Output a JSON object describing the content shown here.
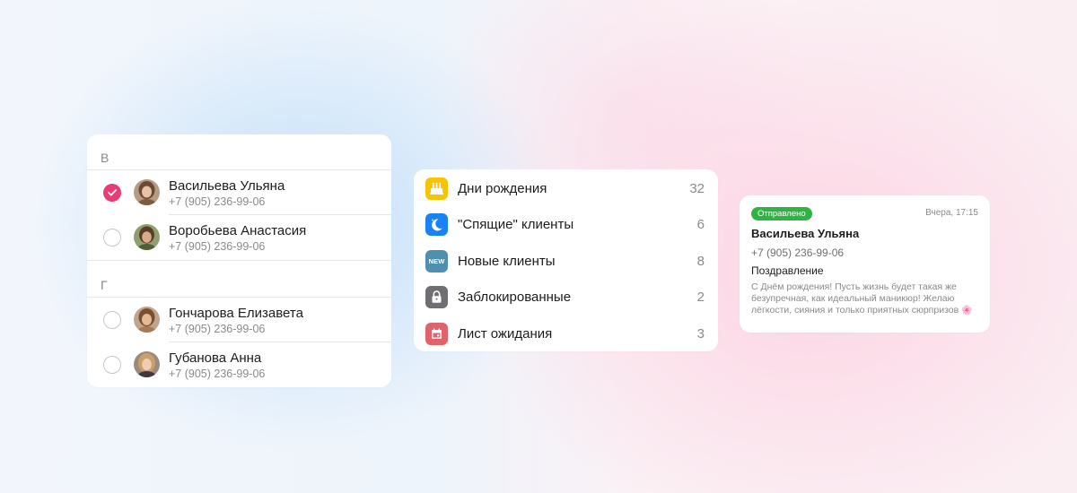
{
  "contacts_card": {
    "sections": [
      {
        "letter": "В",
        "contacts": [
          {
            "name": "Васильева Ульяна",
            "phone": "+7 (905) 236-99-06",
            "selected": true
          },
          {
            "name": "Воробьева Анастасия",
            "phone": "+7 (905) 236-99-06",
            "selected": false
          }
        ]
      },
      {
        "letter": "Г",
        "contacts": [
          {
            "name": "Гончарова Елизавета",
            "phone": "+7 (905) 236-99-06",
            "selected": false
          },
          {
            "name": "Губанова Анна",
            "phone": "+7 (905) 236-99-06",
            "selected": false
          }
        ]
      }
    ],
    "accent_color": "#ea3c74"
  },
  "segments_card": {
    "items": [
      {
        "label": "Дни рождения",
        "count": "32",
        "icon": "cake-icon",
        "color": "#f6c400"
      },
      {
        "label": "\"Спящие\" клиенты",
        "count": "6",
        "icon": "moon-icon",
        "color": "#1a82f7"
      },
      {
        "label": "Новые клиенты",
        "count": "8",
        "icon": "new-badge-icon",
        "icon_text": "NEW",
        "color": "#4f8fb0"
      },
      {
        "label": "Заблокированные",
        "count": "2",
        "icon": "lock-icon",
        "color": "#6e6e73"
      },
      {
        "label": "Лист ожидания",
        "count": "3",
        "icon": "calendar-icon",
        "color": "#e0626b"
      }
    ]
  },
  "message_card": {
    "status": "Отправлено",
    "status_color": "#2fb344",
    "time": "Вчера, 17:15",
    "recipient": "Васильева Ульяна",
    "phone": "+7 (905) 236-99-06",
    "subject": "Поздравление",
    "body": "С Днём рождения! Пусть жизнь будет такая же безупречная, как идеальный маникюр! Желаю лёгкости, сияния и только приятных сюрпризов",
    "emoji": "🌸"
  }
}
